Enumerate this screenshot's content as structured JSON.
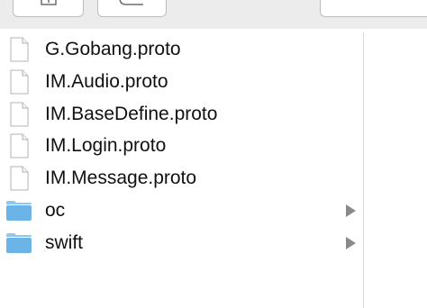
{
  "toolbar": {
    "buttons": [
      {
        "name": "share",
        "icon": "share-icon"
      },
      {
        "name": "tag",
        "icon": "tag-icon"
      },
      {
        "name": "search",
        "icon": "search-field"
      }
    ]
  },
  "files": [
    {
      "name": "G.Gobang.proto",
      "kind": "file",
      "icon": "document-icon"
    },
    {
      "name": "IM.Audio.proto",
      "kind": "file",
      "icon": "document-icon"
    },
    {
      "name": "IM.BaseDefine.proto",
      "kind": "file",
      "icon": "document-icon"
    },
    {
      "name": "IM.Login.proto",
      "kind": "file",
      "icon": "document-icon"
    },
    {
      "name": "IM.Message.proto",
      "kind": "file",
      "icon": "document-icon"
    },
    {
      "name": "oc",
      "kind": "folder",
      "icon": "folder-icon"
    },
    {
      "name": "swift",
      "kind": "folder",
      "icon": "folder-icon"
    }
  ],
  "colors": {
    "folder": "#6ab4e8",
    "folder_tab": "#8ec8ef",
    "arrow": "#8a8a8a",
    "text": "#111111"
  }
}
